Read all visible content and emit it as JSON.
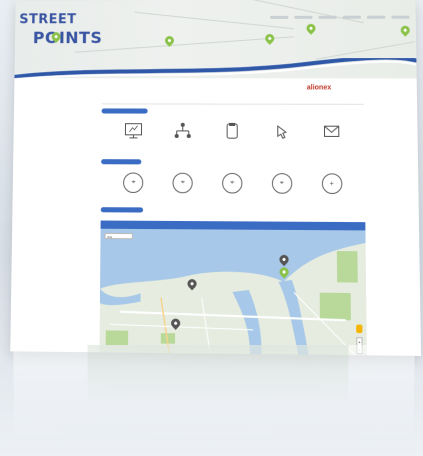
{
  "header": {
    "logo_line1": "STREET",
    "logo_line2": "POINTS",
    "nav": [
      "",
      "",
      "",
      "",
      "",
      "",
      "",
      ""
    ],
    "brand": "alionex"
  },
  "sections": {
    "first": {
      "icons": [
        {
          "icon": "monitor-icon",
          "label": ""
        },
        {
          "icon": "hierarchy-icon",
          "label": ""
        },
        {
          "icon": "clipboard-icon",
          "label": ""
        },
        {
          "icon": "cursor-hand-icon",
          "label": ""
        },
        {
          "icon": "envelope-icon",
          "label": ""
        }
      ]
    },
    "second": {
      "icons": [
        {
          "icon": "map-circle-icon",
          "label": ""
        },
        {
          "icon": "map-circle-icon",
          "label": ""
        },
        {
          "icon": "map-circle-icon",
          "label": ""
        },
        {
          "icon": "map-circle-icon",
          "label": ""
        },
        {
          "icon": "plus-circle-icon",
          "label": ""
        }
      ]
    }
  },
  "map": {
    "toolbar": "Fst",
    "zoom_in": "+",
    "zoom_out": "-"
  },
  "colors": {
    "brand_blue": "#3a56a3",
    "accent_green": "#8bc34a",
    "section_blue": "#3b6cc4",
    "brand_red": "#c0392b",
    "water": "#a7c8e8"
  }
}
